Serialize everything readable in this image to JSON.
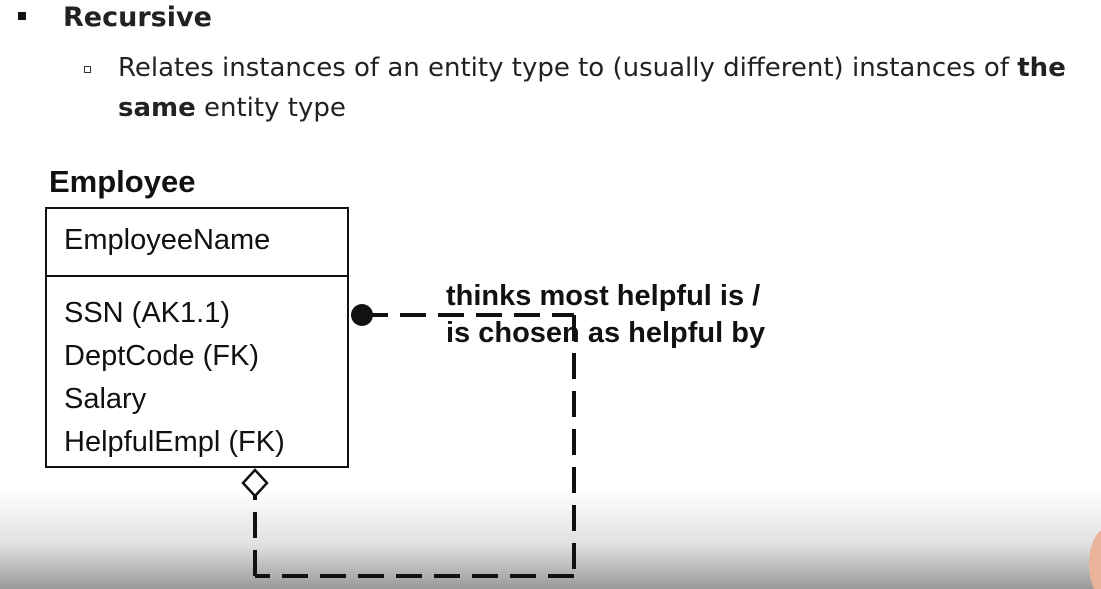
{
  "bullet": {
    "heading": "Recursive",
    "sub_text_part1": "Relates instances of an entity type to (usually different) instances of ",
    "sub_text_bold": "the same",
    "sub_text_part2": " entity type"
  },
  "entity": {
    "name": "Employee",
    "primary_key": "EmployeeName",
    "attributes": [
      "SSN (AK1.1)",
      "DeptCode (FK)",
      "Salary",
      "HelpfulEmpl (FK)"
    ]
  },
  "relationship": {
    "verb_phrase_line1": "thinks most helpful is /",
    "verb_phrase_line2": "is chosen as helpful by"
  },
  "colors": {
    "ink": "#111111",
    "accent_skin": "#e9b299"
  }
}
